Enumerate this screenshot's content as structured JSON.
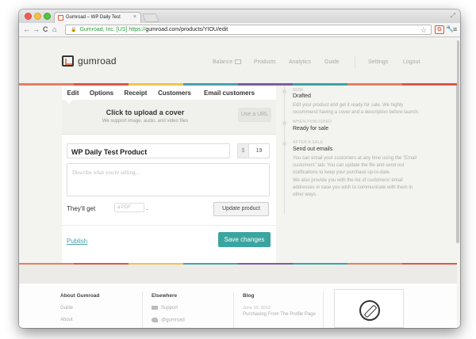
{
  "browser": {
    "tab_title": "Gumroad – WP Daily Test",
    "tab_close": "×",
    "nav_back": "←",
    "nav_forward": "→",
    "nav_reload": "C",
    "nav_home": "⌂",
    "lock": "🔒",
    "ev_cert": "Gumroad, Inc. [US]",
    "url_scheme": "https://",
    "url_rest": "gumroad.com/products/YIOU/edit",
    "star": "☆",
    "ext_label": "G",
    "wrench": "🔧",
    "menu": "≡",
    "resize": "⤢"
  },
  "header": {
    "logo_text": "gumroad",
    "nav": {
      "balance": "Balance",
      "products": "Products",
      "analytics": "Analytics",
      "guide": "Guide",
      "settings": "Settings",
      "logout": "Logout"
    }
  },
  "tabs": [
    "Edit",
    "Options",
    "Receipt",
    "Customers",
    "Email customers"
  ],
  "upload": {
    "title": "Click to upload a cover",
    "subtitle": "We support image, audio, and video files",
    "url_button": "Use a URL"
  },
  "form": {
    "name_value": "WP Daily Test Product",
    "currency": "$",
    "price_value": "19",
    "description_placeholder": "Describe what you're selling...",
    "theyll_get": "They'll get",
    "file_placeholder": "a PDF",
    "period": ".",
    "update_button": "Update product",
    "publish_link": "Publish",
    "save_button": "Save changes"
  },
  "timeline": {
    "step1": {
      "kicker": "NOW",
      "title": "Drafted",
      "text": "Edit your product and get it ready for sale. We highly recommend having a cover and a description before launch."
    },
    "step2": {
      "kicker": "WHEN PUBLISHED",
      "title": "Ready for sale"
    },
    "step3": {
      "kicker": "AFTER A SALE",
      "title": "Send out emails",
      "text1": "You can email your customers at any time using the \"Email customers\" tab. You can update the file and send out notifications to keep your purchase up-to-date.",
      "text2": "We also provide you with the list of customers' email addresses in case you wish to communicate with them in other ways."
    }
  },
  "footer": {
    "about": {
      "heading": "About Gumroad",
      "links": [
        "Guide",
        "About"
      ]
    },
    "elsewhere": {
      "heading": "Elsewhere",
      "links": [
        "Support",
        "@gumroad"
      ]
    },
    "blog": {
      "heading": "Blog",
      "date": "June 10, 2013",
      "post": "Purchasing From The Profile Page"
    }
  },
  "colors": {
    "accent_teal": "#3aa5a0",
    "link_teal": "#4ba1ab",
    "stripe": [
      "#e3815d",
      "#d9574a",
      "#f0c44d",
      "#4ba1ab",
      "#7a5ea3",
      "#3aa5a0",
      "#e3815d",
      "#d9574a"
    ]
  }
}
